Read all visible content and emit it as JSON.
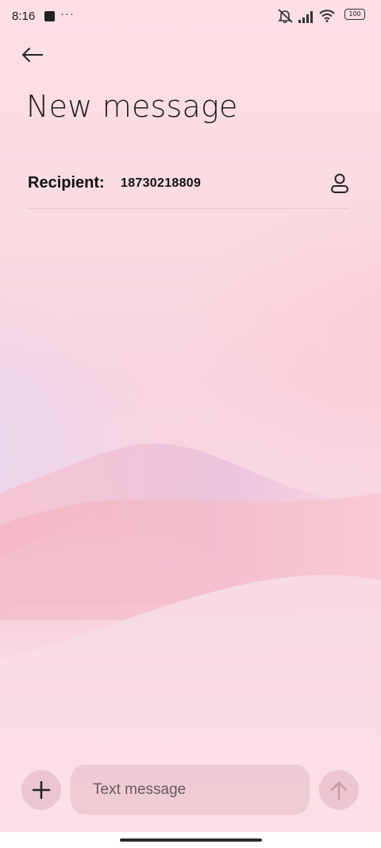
{
  "status_bar": {
    "time": "8:16",
    "dots": "···",
    "battery": "100",
    "icons": [
      "notification-square-icon",
      "mute-icon",
      "signal-icon",
      "wifi-icon",
      "battery-icon"
    ]
  },
  "header": {
    "title": "New message",
    "back_icon": "arrow-left-icon"
  },
  "recipient": {
    "label": "Recipient:",
    "value": "18730218809",
    "contact_icon": "person-icon"
  },
  "compose": {
    "placeholder": "Text message",
    "add_icon": "plus-icon",
    "send_icon": "arrow-up-icon"
  },
  "colors": {
    "background": "#fde0e8",
    "text": "#111111",
    "button_bg": "#e6bec8"
  }
}
